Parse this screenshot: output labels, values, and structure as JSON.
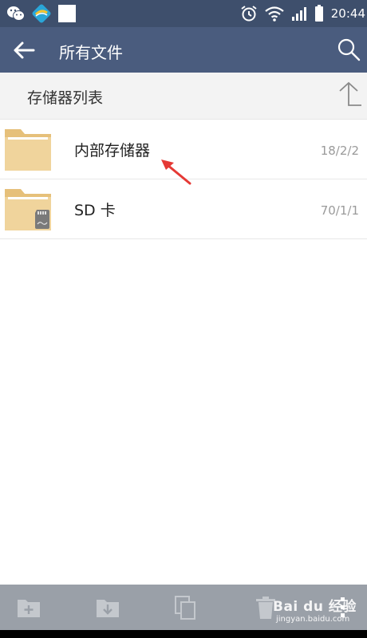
{
  "status_bar": {
    "time": "20:44",
    "left_icons": [
      "wechat-icon",
      "app-icon",
      "blank-square-icon"
    ],
    "right_icons": [
      "alarm-icon",
      "wifi-icon",
      "signal-icon",
      "battery-icon"
    ]
  },
  "app_bar": {
    "title": "所有文件",
    "back_icon": "back-arrow-icon",
    "search_icon": "search-icon"
  },
  "section": {
    "title": "存储器列表",
    "up_icon": "up-arrow-icon"
  },
  "storage_items": [
    {
      "name": "内部存储器",
      "date": "18/2/2",
      "icon": "folder-icon"
    },
    {
      "name": "SD 卡",
      "date": "70/1/1",
      "icon": "sd-folder-icon"
    }
  ],
  "bottom_toolbar": {
    "icons": [
      "new-folder-icon",
      "download-folder-icon",
      "copy-icon",
      "delete-icon",
      "more-icon"
    ]
  },
  "watermark": {
    "main": "Bai du 经验",
    "sub": "jingyan.baidu.com"
  },
  "colors": {
    "status_bar": "#3e4f6c",
    "app_bar": "#4a5c7e",
    "folder": "#f0d49c",
    "annotation_arrow": "#e53935",
    "bottom_toolbar": "#9aa0a8"
  }
}
